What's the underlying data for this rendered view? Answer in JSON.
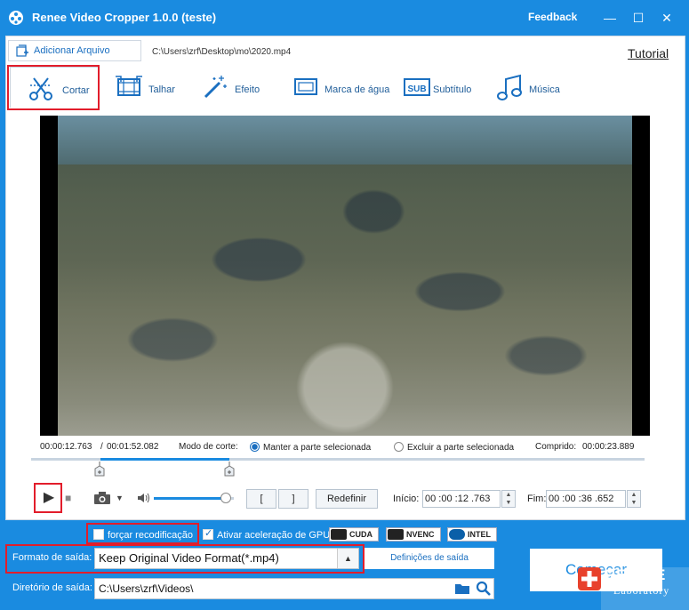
{
  "window": {
    "title": "Renee Video Cropper 1.0.0 (teste)",
    "feedback": "Feedback",
    "minimize": "—",
    "maximize": "☐",
    "close": "✕"
  },
  "toolbar": {
    "add_file": "Adicionar Arquivo",
    "file_path": "C:\\Users\\zrf\\Desktop\\mo\\2020.mp4",
    "tutorial": "Tutorial"
  },
  "tabs": [
    {
      "label": "Cortar",
      "icon": "scissors-icon",
      "active": true
    },
    {
      "label": "Talhar",
      "icon": "film-crop-icon"
    },
    {
      "label": "Efeito",
      "icon": "magic-wand-icon"
    },
    {
      "label": "Marca de água",
      "icon": "watermark-icon"
    },
    {
      "label": "Subtítulo",
      "icon": "subtitle-icon"
    },
    {
      "label": "Música",
      "icon": "music-icon"
    }
  ],
  "timeline": {
    "current_time": "00:00:12.763",
    "separator": "/",
    "total_time": "00:01:52.082",
    "cut_mode_label": "Modo de corte:",
    "keep_selected": "Manter a parte selecionada",
    "exclude_selected": "Excluir a parte selecionada",
    "length_label": "Comprido:",
    "length_value": "00:00:23.889"
  },
  "controls": {
    "play": "▶",
    "stop": "■",
    "camera": "📷",
    "camera_dropdown": "▼",
    "volume": 0.9,
    "bracket_start": "[",
    "bracket_end": "]",
    "reset": "Redefinir",
    "start_label": "Início:",
    "start_value": "00 :00 :12 .763",
    "end_label": "Fim:",
    "end_value": "00 :00 :36 .652"
  },
  "bottom": {
    "force_reencode": "forçar recodificação",
    "gpu_accel": "Ativar aceleração de GPU",
    "gpu_badges": [
      "CUDA",
      "NVENC",
      "INTEL"
    ],
    "format_label": "Formato de saída:",
    "format_value": "Keep Original Video Format(*.mp4)",
    "output_settings": "Definições de saída",
    "dir_label": "Diretório de saída:",
    "dir_value": "C:\\Users\\zrf\\Videos\\",
    "start": "Começar"
  },
  "watermark": {
    "brand": "RENE.E",
    "sub": "Laboratory"
  },
  "colors": {
    "brand_blue": "#1a8be0",
    "highlight_red": "#e21d2b"
  }
}
